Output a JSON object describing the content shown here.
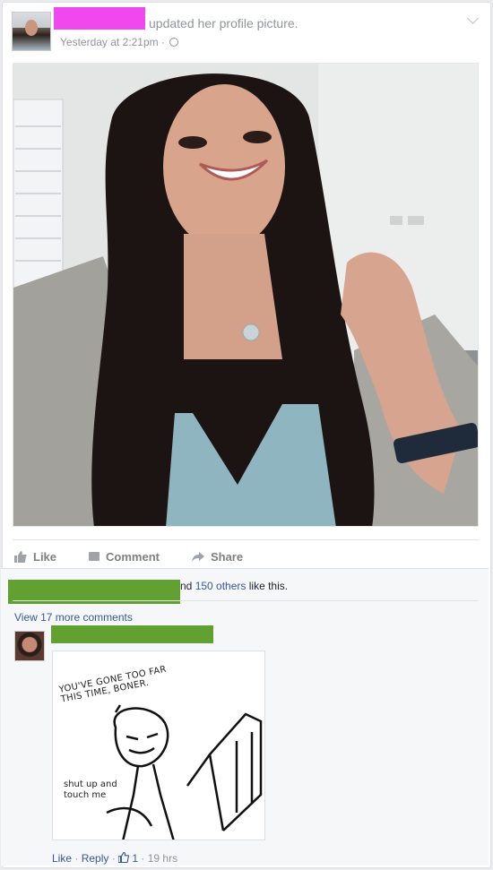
{
  "post": {
    "action": "updated her profile picture.",
    "timestamp": "Yesterday at 2:21pm · "
  },
  "actions": {
    "like": "Like",
    "comment": "Comment",
    "share": "Share"
  },
  "likes": {
    "prefix": "nd ",
    "others": "150 others",
    "suffix": " like this."
  },
  "comments": {
    "view_more": "View 17 more comments",
    "meme_top": "YOU'VE GONE TOO FAR\nTHIS TIME, BONER.",
    "meme_bottom": "shut up and\ntouch me",
    "footer": {
      "like": "Like",
      "sep1": " · ",
      "reply": "Reply",
      "sep2": " · ",
      "count": "1",
      "sep3": " · ",
      "time": "19 hrs"
    }
  },
  "colors": {
    "name_redaction": "#ee48ee",
    "green_redaction": "#62a031",
    "link": "#365899"
  }
}
